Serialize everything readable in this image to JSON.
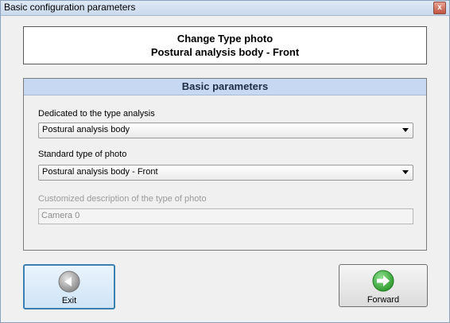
{
  "window": {
    "title": "Basic configuration parameters",
    "close_glyph": "x"
  },
  "header": {
    "line1": "Change Type photo",
    "line2": "Postural analysis  body - Front"
  },
  "group": {
    "title": "Basic parameters",
    "analysis_label": "Dedicated to the type analysis",
    "analysis_value": "Postural analysis  body",
    "photo_type_label": "Standard type of photo",
    "photo_type_value": "Postural analysis  body - Front",
    "custom_desc_label": "Customized description of the type of photo",
    "custom_desc_value": "Camera 0"
  },
  "buttons": {
    "exit_label": "Exit",
    "forward_label": "Forward"
  },
  "icons": {
    "exit": "back-arrow-icon",
    "forward": "forward-arrow-icon",
    "dropdown": "chevron-down-icon",
    "close": "close-icon"
  },
  "colors": {
    "group_header": "#c7d9f2",
    "forward_icon": "#2f9a2f",
    "exit_icon": "#8a8a8a",
    "close_button": "#c0533e"
  }
}
